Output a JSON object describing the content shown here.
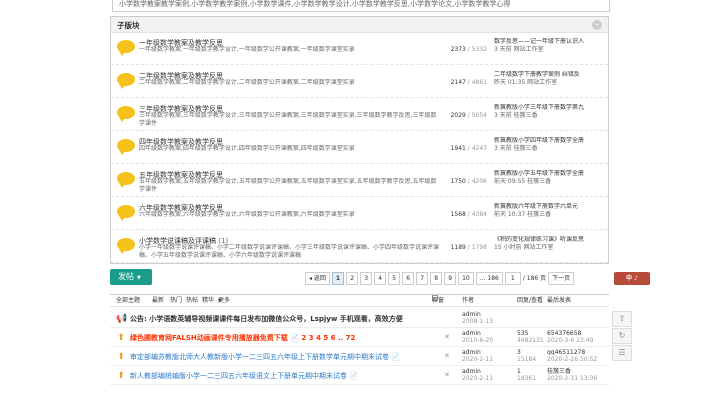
{
  "top_desc": "小学数学教案教学案例,小学数学教学案例,小学数学课件,小学数学教学设计,小学数学教学反思,小学数学论文,小学数学教学心得",
  "subforum": {
    "title": "子版块",
    "forums": [
      {
        "name": "一年级数学教案及教学反思",
        "count": "",
        "desc": "一年级数学教案,一年级数学教学设计,一年级数学公开课教案,一年级数学课堂实录",
        "threads": "2373",
        "posts": "5332",
        "last_title": "数学反思——记一年级下册认识人",
        "last_time": "3 天前",
        "last_user": "网站工作室"
      },
      {
        "name": "二年级数学教案及教学反思",
        "count": "",
        "desc": "二年级数学教案,二年级数学教学设计,二年级数学公开课教案,二年级数学课堂实录",
        "threads": "2147",
        "posts": "4861",
        "last_title": "二年级数学下册教学案例 纠错反",
        "last_time": "昨天 01:35",
        "last_user": "网站工作室"
      },
      {
        "name": "三年级数学教案及教学反思",
        "count": "",
        "desc": "三年级数学教案,三年级数学教学设计,三年级数学公开课教案,三年级数学课堂实录,三年级数学教学反思,三年级数学课件",
        "threads": "2029",
        "posts": "5054",
        "last_title": "新冀教版小学三年级下册数学第九",
        "last_time": "3 天前",
        "last_user": "桂簇三香"
      },
      {
        "name": "四年级数学教案及教学反思",
        "count": "",
        "desc": "四年级数学教案,四年级数学教学设计,四年级数学公开课教案,四年级数学课堂实录",
        "threads": "1941",
        "posts": "4247",
        "last_title": "新冀教版小学四年级下册数学全册",
        "last_time": "3 天前",
        "last_user": "桂簇三香"
      },
      {
        "name": "五年级数学教案及教学反思",
        "count": "",
        "desc": "五年级数学教案,五年级数学教学设计,五年级数学公开课教案,五年级数学课堂实录,五年级数学教学反思,五年级数学课件",
        "threads": "1750",
        "posts": "4206",
        "last_title": "新冀教版小学五年级下册数学全册",
        "last_time": "前天 09:55",
        "last_user": "桂簇三香"
      },
      {
        "name": "六年级数学教案及教学反思",
        "count": "",
        "desc": "六年级数学教案,六年级数学教学设计,六年级数学公开课教案,六年级数学课堂实录",
        "threads": "1568",
        "posts": "4384",
        "last_title": "新冀教版六年级下册数学六单元",
        "last_time": "前天 10:37",
        "last_user": "桂簇三香"
      },
      {
        "name": "小学数学说课稿及评课稿",
        "count": "(1)",
        "desc": "小学一年级数学说课评课稿、小学二年级数学说课评课稿、小学三年级数学说课评课稿、小学四年级数学说课评课稿、小学五年级数学说课评课稿、小学六年级数学说课评课稿",
        "threads": "1189",
        "posts": "1798",
        "last_title": "《积的变化规律练习课》听课反思",
        "last_time": "15 小时前",
        "last_user": "网站工作室"
      }
    ]
  },
  "toolbar": {
    "post_label": "发帖",
    "pager": {
      "prev": "◂ 返回",
      "pages": [
        "1",
        "2",
        "3",
        "4",
        "5",
        "6",
        "7",
        "8",
        "9",
        "10",
        "... 186"
      ],
      "current": "1",
      "input_value": "1",
      "total": "/ 186 页",
      "next": "下一页"
    },
    "right_tool": "中 ♪"
  },
  "thread_head": {
    "all": "全部主题",
    "latest": "最新",
    "hot": "热门",
    "hottest": "热帖",
    "digest": "精华",
    "more": "更多",
    "new_window": "新窗",
    "author": "作者",
    "reply_view": "回复/查看",
    "last_post": "最后发表"
  },
  "threads": [
    {
      "icon": "📢",
      "color": "#333333",
      "bold": true,
      "title": "公告: 小学语数英辅导视频课课件每日发布加微信公众号，Lspjyw 手机观看，高效方便",
      "author": "admin",
      "date": "2008-1-13",
      "replies": "",
      "views": "",
      "last_user": "",
      "last_date": "",
      "close": ""
    },
    {
      "icon": "⬆",
      "color": "#ff3300",
      "bold": true,
      "title": "绿色圃教育网FALSH动画课件专用播放器免费下载 📄 2 3 4 5 6 .. 72",
      "author": "admin",
      "date": "2010-6-20",
      "replies": "535",
      "views": "4682131",
      "last_user": "654376658",
      "last_date": "2020-3-6 23:49",
      "close": "✕"
    },
    {
      "icon": "⬆",
      "color": "#2b7acc",
      "bold": false,
      "title": "审定部编苏教版北师大人教新版小学一二三四五六年级上下册数学单元期中期末试卷 📄",
      "author": "admin",
      "date": "2020-2-11",
      "replies": "3",
      "views": "15184",
      "last_user": "qq46511278",
      "last_date": "2020-2-26 10:52",
      "close": "✕"
    },
    {
      "icon": "⬆",
      "color": "#2b7acc",
      "bold": false,
      "title": "新人教部编统编版小学一二三四五六年级语文上下册单元期中期末试卷 📄",
      "author": "admin",
      "date": "2020-2-11",
      "replies": "1",
      "views": "18361",
      "last_user": "桂簇三香",
      "last_date": "2020-2-11 13:36",
      "close": "✕"
    }
  ],
  "side_tools": [
    "⇪",
    "↻",
    "☰"
  ]
}
